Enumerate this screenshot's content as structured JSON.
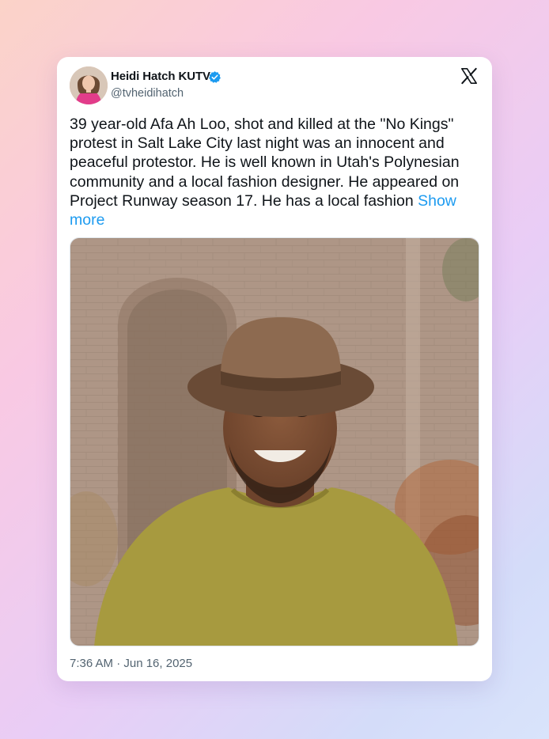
{
  "tweet": {
    "display_name": "Heidi Hatch KUTV",
    "handle": "@tvheidihatch",
    "text": "39 year-old Afa Ah Loo, shot and killed at the \"No Kings\" protest in Salt Lake City last night was an innocent and peaceful protestor. He is well known in Utah's Polynesian community and a local fashion designer. He appeared on Project Runway season 17. He has a local fashion",
    "show_more": "Show more",
    "timestamp": "7:36 AM · Jun 16, 2025"
  },
  "icons": {
    "verified": "verified-badge-icon",
    "platform": "x-logo-icon"
  },
  "colors": {
    "link": "#1d9bf0",
    "text": "#0f1419",
    "secondary": "#536471"
  }
}
